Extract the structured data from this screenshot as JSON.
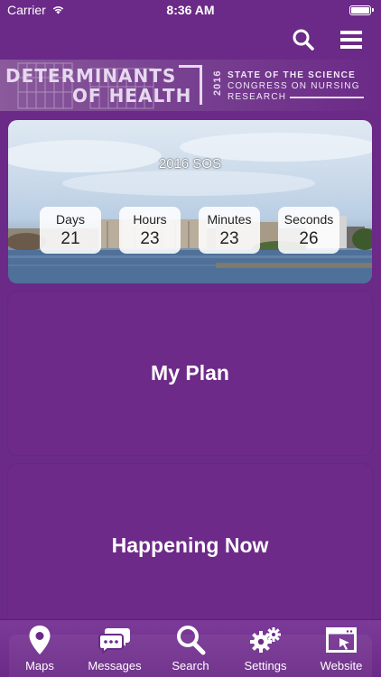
{
  "status_bar": {
    "carrier": "Carrier",
    "time": "8:36 AM"
  },
  "nav": {
    "search_icon": "search-icon",
    "menu_icon": "hamburger-menu-icon"
  },
  "banner": {
    "title_line1": "DETERMINANTS",
    "title_line2": "OF HEALTH",
    "year": "2016",
    "subtitle_line1": "STATE OF THE SCIENCE",
    "subtitle_line2": "CONGRESS ON NURSING",
    "subtitle_line3": "RESEARCH"
  },
  "countdown": {
    "title": "2016 SOS",
    "units": [
      {
        "label": "Days",
        "value": "21"
      },
      {
        "label": "Hours",
        "value": "23"
      },
      {
        "label": "Minutes",
        "value": "23"
      },
      {
        "label": "Seconds",
        "value": "26"
      }
    ]
  },
  "main_buttons": {
    "plan_label": "My Plan",
    "now_label": "Happening Now"
  },
  "tabs": [
    {
      "label": "Maps",
      "icon": "map-pin-icon"
    },
    {
      "label": "Messages",
      "icon": "chat-bubbles-icon"
    },
    {
      "label": "Search",
      "icon": "search-icon"
    },
    {
      "label": "Settings",
      "icon": "gears-icon"
    },
    {
      "label": "Website",
      "icon": "browser-window-icon"
    }
  ],
  "colors": {
    "brand_purple": "#6b2a87",
    "button_purple": "#6d2a88"
  }
}
